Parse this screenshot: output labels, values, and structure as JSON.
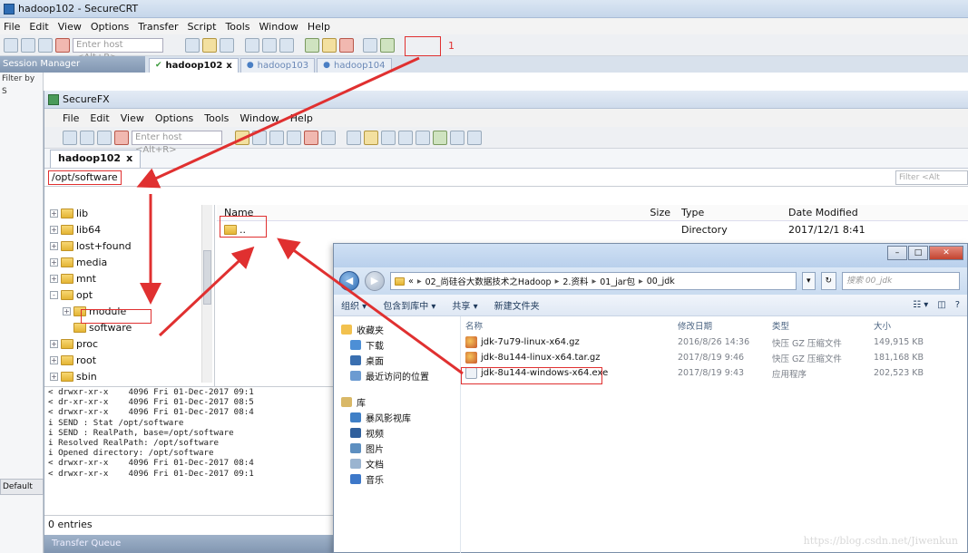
{
  "crt": {
    "title": "hadoop102 - SecureCRT",
    "menu": [
      "File",
      "Edit",
      "View",
      "Options",
      "Transfer",
      "Script",
      "Tools",
      "Window",
      "Help"
    ],
    "host_placeholder": "Enter host <Alt+R>",
    "annotation_number": "1",
    "session_manager_label": "Session Manager",
    "tabs": [
      {
        "label": "hadoop102",
        "active": true,
        "close": "x"
      },
      {
        "label": "hadoop103",
        "active": false,
        "close": ""
      },
      {
        "label": "hadoop104",
        "active": false,
        "close": ""
      }
    ],
    "left_rows": [
      "Filter by",
      "S"
    ],
    "default_button": "Default"
  },
  "fx": {
    "title": "SecureFX",
    "menu": [
      "File",
      "Edit",
      "View",
      "Options",
      "Tools",
      "Window",
      "Help"
    ],
    "host_placeholder": "Enter host <Alt+R>",
    "tab": {
      "label": "hadoop102",
      "close": "x"
    },
    "path": "/opt/software",
    "filter_placeholder": "Filter <Alt",
    "tree": [
      {
        "label": "lib",
        "level": 0,
        "expander": "+"
      },
      {
        "label": "lib64",
        "level": 0,
        "expander": "+"
      },
      {
        "label": "lost+found",
        "level": 0,
        "expander": "+"
      },
      {
        "label": "media",
        "level": 0,
        "expander": "+"
      },
      {
        "label": "mnt",
        "level": 0,
        "expander": "+"
      },
      {
        "label": "opt",
        "level": 0,
        "expander": "-"
      },
      {
        "label": "module",
        "level": 1,
        "expander": "+"
      },
      {
        "label": "software",
        "level": 1,
        "expander": ""
      },
      {
        "label": "proc",
        "level": 0,
        "expander": "+"
      },
      {
        "label": "root",
        "level": 0,
        "expander": "+"
      },
      {
        "label": "sbin",
        "level": 0,
        "expander": "+"
      }
    ],
    "list_columns": {
      "name": "Name",
      "size": "Size",
      "type": "Type",
      "date": "Date Modified"
    },
    "list_rows": [
      {
        "name": "..",
        "size": "",
        "type": "Directory",
        "date": "2017/12/1 8:41"
      }
    ],
    "log_lines": [
      "< drwxr-xr-x    4096 Fri 01-Dec-2017 09:1",
      "< dr-xr-xr-x    4096 Fri 01-Dec-2017 08:5",
      "< drwxr-xr-x    4096 Fri 01-Dec-2017 08:4",
      "i SEND : Stat /opt/software",
      "i SEND : RealPath, base=/opt/software",
      "i Resolved RealPath: /opt/software",
      "i Opened directory: /opt/software",
      "< drwxr-xr-x    4096 Fri 01-Dec-2017 08:4",
      "< drwxr-xr-x    4096 Fri 01-Dec-2017 09:1"
    ],
    "status": "0 entries",
    "transfer_queue": "Transfer Queue"
  },
  "explorer": {
    "address_parts": [
      "«",
      "02_尚硅谷大数据技术之Hadoop",
      "2.资料",
      "01_jar包",
      "00_jdk"
    ],
    "search_placeholder": "搜索 00_jdk",
    "refresh": "↻",
    "commands": [
      "组织 ▾",
      "包含到库中 ▾",
      "共享 ▾",
      "新建文件夹"
    ],
    "view_controls": [
      "☷ ▾",
      "◫",
      "?"
    ],
    "nav": [
      {
        "label": "收藏夹",
        "sub": false,
        "color": "#f2c14e"
      },
      {
        "label": "下载",
        "sub": true,
        "color": "#4d8fd6"
      },
      {
        "label": "桌面",
        "sub": true,
        "color": "#3a6fb0"
      },
      {
        "label": "最近访问的位置",
        "sub": true,
        "color": "#6c9bd1"
      },
      {
        "label": "库",
        "sub": false,
        "color": "#d9b867"
      },
      {
        "label": "暴风影视库",
        "sub": true,
        "color": "#3f7fc6"
      },
      {
        "label": "视频",
        "sub": true,
        "color": "#2f5f9c"
      },
      {
        "label": "图片",
        "sub": true,
        "color": "#5d8fc0"
      },
      {
        "label": "文档",
        "sub": true,
        "color": "#9ab4d0"
      },
      {
        "label": "音乐",
        "sub": true,
        "color": "#3d78c9"
      }
    ],
    "columns": {
      "name": "名称",
      "date": "修改日期",
      "type": "类型",
      "size": "大小"
    },
    "files": [
      {
        "name": "jdk-7u79-linux-x64.gz",
        "date": "2016/8/26 14:36",
        "type": "快压 GZ 压缩文件",
        "size": "149,915 KB",
        "icon": "archive",
        "highlighted": false
      },
      {
        "name": "jdk-8u144-linux-x64.tar.gz",
        "date": "2017/8/19 9:46",
        "type": "快压 GZ 压缩文件",
        "size": "181,168 KB",
        "icon": "archive",
        "highlighted": true
      },
      {
        "name": "jdk-8u144-windows-x64.exe",
        "date": "2017/8/19 9:43",
        "type": "应用程序",
        "size": "202,523 KB",
        "icon": "exe",
        "highlighted": false
      }
    ],
    "watermark": "https://blog.csdn.net/Jiwenkun"
  },
  "colors": {
    "annotation_red": "#e03030",
    "folder_yellow": "#f2c94c",
    "link_blue": "#2a5590"
  }
}
